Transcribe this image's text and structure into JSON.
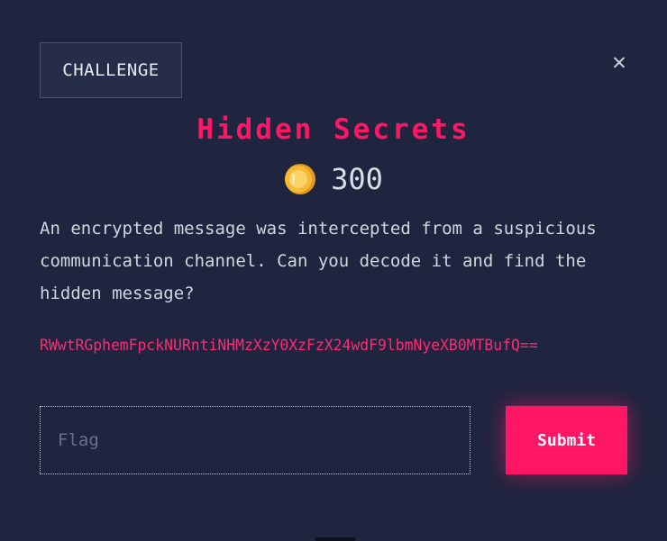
{
  "modal": {
    "category": "CHALLENGE",
    "close_symbol": "✕",
    "title": "Hidden Secrets",
    "points": "300",
    "description": "An encrypted message was intercepted from a suspicious communication channel. Can you decode it and find the hidden message?",
    "ciphertext": "RWwtRGphemFpckNURntiNHMzXzY0XzFzX24wdF9lbmNyeXB0MTBufQ==",
    "flag_input": {
      "placeholder": "Flag",
      "value": ""
    },
    "submit_label": "Submit"
  },
  "colors": {
    "background": "#1f253e",
    "accent": "#ff1766",
    "coin": "#f5b935"
  },
  "icons": {
    "close": "close-icon",
    "points": "coin-icon"
  }
}
